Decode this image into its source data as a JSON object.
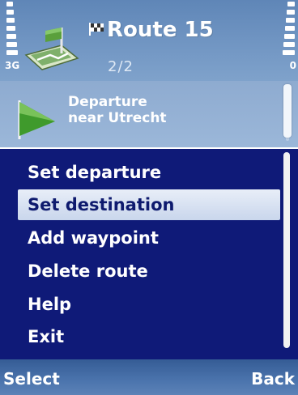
{
  "status": {
    "network_label": "3G",
    "battery_label": "0"
  },
  "header": {
    "title": "Route 15",
    "page_indicator": "2/2",
    "app_icon": "route-map-icon",
    "flag_icon": "checkered-flag-icon"
  },
  "route_info": {
    "icon": "green-flag-icon",
    "line1": "Departure",
    "line2": "near Utrecht"
  },
  "menu": {
    "items": [
      {
        "label": "Set departure"
      },
      {
        "label": "Set destination"
      },
      {
        "label": "Add waypoint"
      },
      {
        "label": "Delete route"
      },
      {
        "label": "Help"
      },
      {
        "label": "Exit"
      }
    ],
    "selected_index": 1
  },
  "softkeys": {
    "left": "Select",
    "right": "Back"
  },
  "colors": {
    "menu_background": "#0f1a78",
    "highlight": "#d4def0",
    "header": "#6e93c1"
  }
}
